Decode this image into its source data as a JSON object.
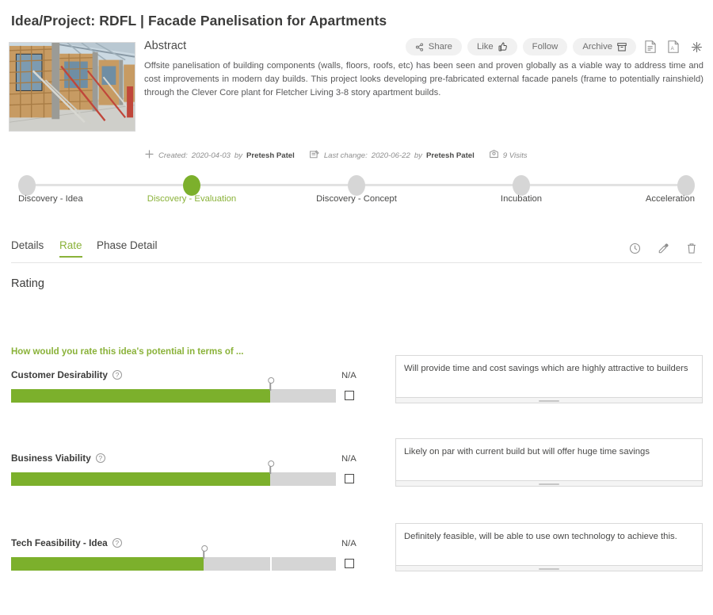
{
  "page_title": "Idea/Project: RDFL | Facade Panelisation for Apartments",
  "hero": {
    "thumbnail_alt": "construction-site-timber-framing-photo",
    "abstract_heading": "Abstract",
    "abstract_text": "Offsite panelisation of building components (walls, floors, roofs, etc) has been seen and proven globally as a viable way to address time and cost improvements in modern day builds. This project looks developing pre-fabricated external facade panels (frame to potentially rainshield) through the Clever Core plant for Fletcher Living 3-8 story apartment builds."
  },
  "actions": {
    "share": "Share",
    "like": "Like",
    "follow": "Follow",
    "archive": "Archive",
    "icons": [
      "report-icon",
      "pdf-icon",
      "sparkle-icon"
    ]
  },
  "meta": {
    "created_label": "Created:",
    "created_date": "2020-04-03",
    "created_by_prefix": "by",
    "created_by": "Pretesh Patel",
    "lastchange_label": "Last change:",
    "lastchange_date": "2020-06-22",
    "lastchange_by_prefix": "by",
    "lastchange_by": "Pretesh Patel",
    "visits": "9 Visits"
  },
  "stepper": {
    "active_index": 1,
    "steps": [
      {
        "label": "Discovery - Idea",
        "active": false
      },
      {
        "label": "Discovery - Evaluation",
        "active": true
      },
      {
        "label": "Discovery - Concept",
        "active": false
      },
      {
        "label": "Incubation",
        "active": false
      },
      {
        "label": "Acceleration",
        "active": false
      }
    ]
  },
  "tabs": {
    "items": [
      {
        "label": "Details",
        "active": false
      },
      {
        "label": "Rate",
        "active": true
      },
      {
        "label": "Phase Detail",
        "active": false
      }
    ],
    "icons": [
      "history-clock-icon",
      "edit-pencil-icon",
      "delete-trash-icon"
    ]
  },
  "rating": {
    "heading": "Rating",
    "question": "How would you rate this idea's potential in terms of ...",
    "na_label": "N/A",
    "criteria": [
      {
        "label": "Customer Desirability",
        "help_icon": "help-question-icon",
        "value_pct": 79.8,
        "na_checked": false,
        "comment": "Will provide time and cost savings which are highly attractive to builders",
        "segments": []
      },
      {
        "label": "Business Viability",
        "help_icon": "help-question-icon",
        "value_pct": 79.8,
        "na_checked": false,
        "comment": "Likely on par with current build but will offer huge time savings",
        "segments": []
      },
      {
        "label": "Tech Feasibility - Idea",
        "help_icon": "help-question-icon",
        "value_pct": 59.3,
        "na_checked": false,
        "comment": "Definitely feasible, will be able to use own technology to achieve this.",
        "segments": [
          79.8
        ]
      }
    ]
  },
  "colors": {
    "accent_green": "#8ab239",
    "fill_green": "#7cb02c",
    "track_grey": "#d5d5d5",
    "text_dark": "#3c3c3b"
  }
}
